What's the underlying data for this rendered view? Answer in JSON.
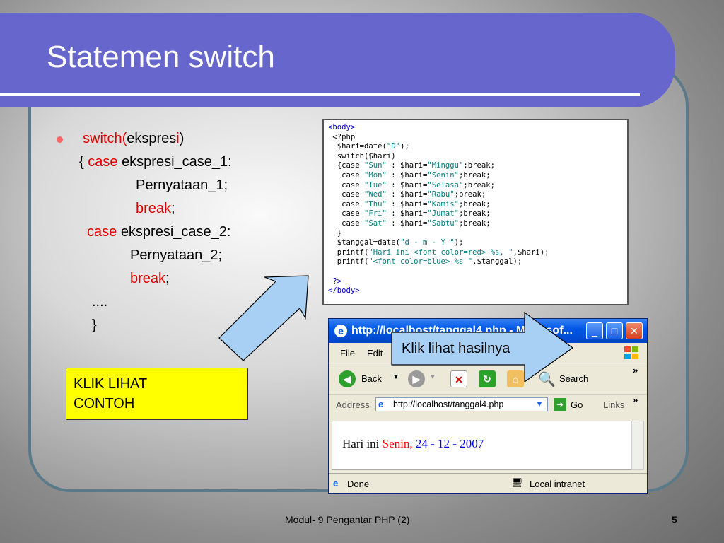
{
  "slide": {
    "title": "Statemen switch",
    "syntax": {
      "l1_kw": "switch(",
      "l1_a": "ekspres",
      "l1_b": "i",
      "l1_c": ")",
      "l2_brace": "{",
      "case_kw": "case",
      "l2_expr": "ekspresi_case_1:",
      "l3": "Pernyataan_1;",
      "break_kw": "break",
      "semicolon": ";",
      "l5_expr": "ekspresi_case_2:",
      "l6": "Pernyataan_2;",
      "l8": "....",
      "l9": "}"
    },
    "klik_box": {
      "line1": "KLIK LIHAT",
      "line2": "CONTOH"
    },
    "callout": "Klik lihat hasilnya",
    "footer": "Modul- 9  Pengantar PHP (2)",
    "page_number": "5"
  },
  "code": {
    "t_body_open": "<body>",
    "l_php_open": " <?php",
    "l_hari_a": "  $hari=date(",
    "l_hari_s": "\"D\"",
    "l_hari_b": ");",
    "l_switch": "  switch($hari)",
    "cases": [
      {
        "pre": "  {case ",
        "day": "\"Sun\"",
        "mid": " : $hari=",
        "name": "\"Minggu\"",
        "post": ";break;"
      },
      {
        "pre": "   case ",
        "day": "\"Mon\"",
        "mid": " : $hari=",
        "name": "\"Senin\"",
        "post": ";break;"
      },
      {
        "pre": "   case ",
        "day": "\"Tue\"",
        "mid": " : $hari=",
        "name": "\"Selasa\"",
        "post": ";break;"
      },
      {
        "pre": "   case ",
        "day": "\"Wed\"",
        "mid": " : $hari=",
        "name": "\"Rabu\"",
        "post": ";break;"
      },
      {
        "pre": "   case ",
        "day": "\"Thu\"",
        "mid": " : $hari=",
        "name": "\"Kamis\"",
        "post": ";break;"
      },
      {
        "pre": "   case ",
        "day": "\"Fri\"",
        "mid": " : $hari=",
        "name": "\"Jumat\"",
        "post": ";break;"
      },
      {
        "pre": "   case ",
        "day": "\"Sat\"",
        "mid": " : $hari=",
        "name": "\"Sabtu\"",
        "post": ";break;"
      }
    ],
    "l_close": "  }",
    "l_tgl_a": "  $tanggal=date(",
    "l_tgl_s": "\"d - m - Y \"",
    "l_tgl_b": ");",
    "l_pf1_a": "  printf(",
    "l_pf1_s": "\"Hari ini <font color=red> %s, \"",
    "l_pf1_b": ",$hari);",
    "l_pf2_a": "  printf(",
    "l_pf2_s": "\"<font color=blue> %s \"",
    "l_pf2_b": ",$tanggal);",
    "l_php_close": " ?>",
    "t_body_close": "</body>"
  },
  "browser": {
    "title": "http://localhost/tanggal4.php - Microsof...",
    "menu": [
      "File",
      "Edit"
    ],
    "toolbar": {
      "back": "Back",
      "search": "Search"
    },
    "address_label": "Address",
    "address_url": "http://localhost/tanggal4.php",
    "go_label": "Go",
    "links_label": "Links",
    "output_prefix": "Hari ini ",
    "output_day": "Senin,",
    "output_date": " 24 - 12 - 2007",
    "status_left": "Done",
    "status_right": "Local intranet",
    "colors": {
      "day": "#ff0000",
      "date": "#0000ff"
    }
  }
}
